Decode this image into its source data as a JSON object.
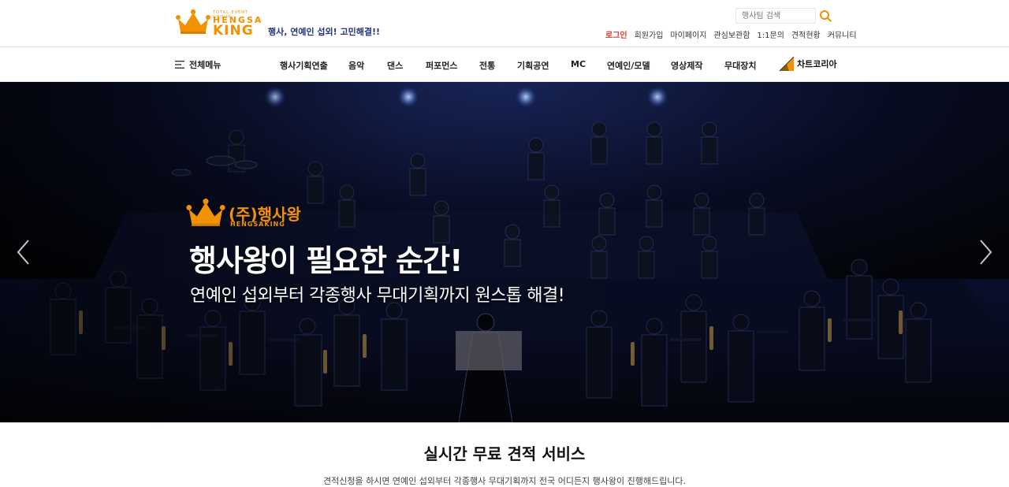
{
  "header": {
    "logo": {
      "tagline": "TOTAL EVENT GROUP",
      "line1": "HENGSA",
      "line2": "KING"
    },
    "slogan": "행사, 연예인 섭외! 고민해결!!",
    "search": {
      "placeholder": "행사팀 검색"
    },
    "links": [
      {
        "label": "로그인"
      },
      {
        "label": "회원가입"
      },
      {
        "label": "마이페이지"
      },
      {
        "label": "관심보관함"
      },
      {
        "label": "1:1문의"
      },
      {
        "label": "견적현황"
      },
      {
        "label": "커뮤니티"
      }
    ],
    "colors": {
      "brand_orange": "#f39200",
      "slogan_navy": "#25337f",
      "login_red": "#e03a2b"
    }
  },
  "gnb": {
    "all_menu_label": "전체메뉴",
    "items": [
      {
        "label": "행사기획연출"
      },
      {
        "label": "음악"
      },
      {
        "label": "댄스"
      },
      {
        "label": "퍼포먼스"
      },
      {
        "label": "전통"
      },
      {
        "label": "기획공연"
      },
      {
        "label": "MC"
      },
      {
        "label": "연예인/모델"
      },
      {
        "label": "영상제작"
      },
      {
        "label": "무대장치"
      }
    ],
    "partner_label": "차트코리아"
  },
  "hero": {
    "logo_korean": "(주)행사왕",
    "logo_roman": "HENGSAKING",
    "title": "행사왕이 필요한 순간!",
    "subtitle": "연예인 섭외부터 각종행사 무대기획까지 원스톱 해결!",
    "prev_icon": "chevron-left-icon",
    "next_icon": "chevron-right-icon"
  },
  "section": {
    "title": "실시간 무료 견적 서비스",
    "description": "견적신청을 하시면 연예인 섭외부터 각종행사 무대기획까지 전국 어디든지 행사왕이 진행해드립니다."
  }
}
